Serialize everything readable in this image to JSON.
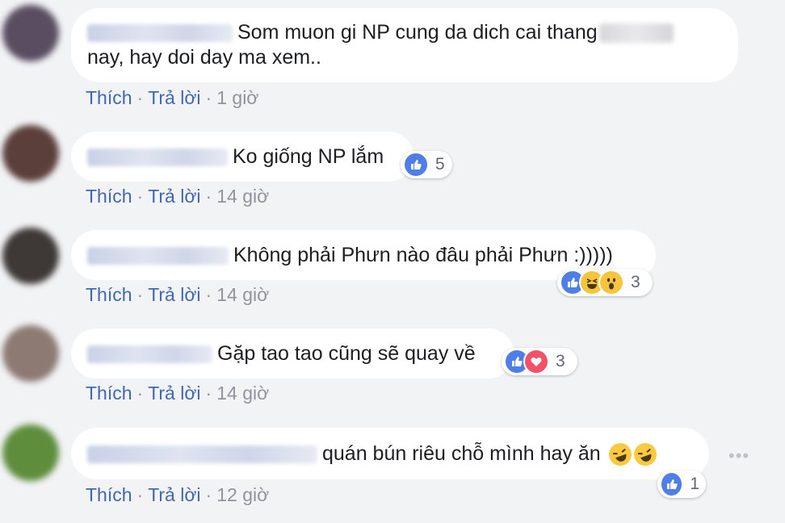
{
  "comments": [
    {
      "text_before": "Som muon gi NP cung da dich cai thang",
      "text_after": "nay, hay doi day ma xem..",
      "reaction_count": "",
      "actions": {
        "like": "Thích",
        "reply": "Trả lời",
        "time": "1 giờ"
      },
      "avatar_color": "#5a4d62"
    },
    {
      "text": "Ko giống NP lắm",
      "reaction_count": "5",
      "reactions": [
        "like"
      ],
      "actions": {
        "like": "Thích",
        "reply": "Trả lời",
        "time": "14 giờ"
      },
      "avatar_color": "#5b3f3b"
    },
    {
      "text": "Không phải Phưn nào đâu phải Phưn :)))))",
      "reaction_count": "3",
      "reactions": [
        "like",
        "haha",
        "wow"
      ],
      "actions": {
        "like": "Thích",
        "reply": "Trả lời",
        "time": "14 giờ"
      },
      "avatar_color": "#3e3936"
    },
    {
      "text": "Gặp tao tao cũng sẽ quay về",
      "reaction_count": "3",
      "reactions": [
        "like",
        "love"
      ],
      "actions": {
        "like": "Thích",
        "reply": "Trả lời",
        "time": "14 giờ"
      },
      "avatar_color": "#8c7a73"
    },
    {
      "text": "quán bún riêu chỗ mình hay ăn",
      "reaction_count": "1",
      "reactions": [
        "like"
      ],
      "actions": {
        "like": "Thích",
        "reply": "Trả lời",
        "time": "12 giờ"
      },
      "avatar_color": "#5e8d3c"
    }
  ],
  "separator": "·",
  "more_options": "•••",
  "colors": {
    "background": "#f2f3f5",
    "link": "#4267b2",
    "meta": "#90949c",
    "like": "#4f7fe6",
    "love": "#f25268"
  }
}
